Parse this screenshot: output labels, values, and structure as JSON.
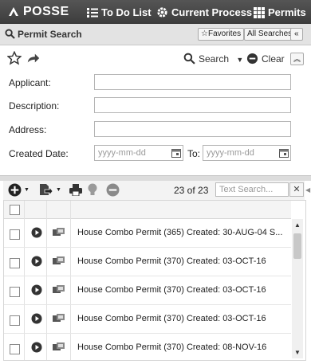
{
  "topbar": {
    "brand": "POSSE",
    "nav": [
      {
        "label": "To Do List",
        "icon": "list-icon"
      },
      {
        "label": "Current Process",
        "icon": "gear-icon"
      },
      {
        "label": "Permits",
        "icon": "grid-icon"
      }
    ]
  },
  "panel": {
    "title": "Permit Search",
    "favorites_label": "Favorites",
    "all_searches_label": "All Searches",
    "collapse_label": "«"
  },
  "search_toolbar": {
    "search_label": "Search",
    "clear_label": "Clear"
  },
  "form": {
    "applicant_label": "Applicant:",
    "description_label": "Description:",
    "address_label": "Address:",
    "created_date_label": "Created Date:",
    "to_label": "To:",
    "date_from_placeholder": "yyyy-mm-dd",
    "date_to_placeholder": "yyyy-mm-dd"
  },
  "grid": {
    "count_text": "23 of 23",
    "text_search_placeholder": "Text Search...",
    "clear_search_label": "✕",
    "rows": [
      {
        "text": "House Combo Permit (365) Created: 30-AUG-04  S..."
      },
      {
        "text": "House Combo Permit (370) Created: 03-OCT-16"
      },
      {
        "text": "House Combo Permit (370) Created: 03-OCT-16"
      },
      {
        "text": "House Combo Permit (370) Created: 03-OCT-16"
      },
      {
        "text": "House Combo Permit (370) Created: 08-NOV-16"
      }
    ]
  },
  "colors": {
    "topbar": "#444444",
    "panel_header": "#e3e3e3",
    "border": "#b5b5b5"
  }
}
